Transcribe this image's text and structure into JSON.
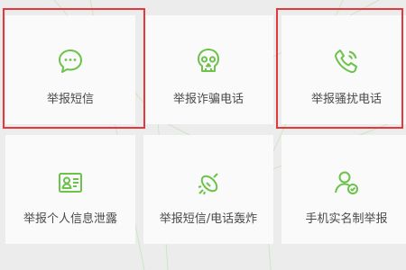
{
  "accent_color": "#6cc24a",
  "highlight_color": "#e4393c",
  "tiles": [
    {
      "label": "举报短信",
      "icon": "chat-bubble-icon",
      "highlighted": true
    },
    {
      "label": "举报诈骗电话",
      "icon": "skull-icon",
      "highlighted": false
    },
    {
      "label": "举报骚扰电话",
      "icon": "phone-icon",
      "highlighted": true
    },
    {
      "label": "举报个人信息泄露",
      "icon": "id-card-icon",
      "highlighted": false
    },
    {
      "label": "举报短信/电话轰炸",
      "icon": "bomb-icon",
      "highlighted": false
    },
    {
      "label": "手机实名制举报",
      "icon": "user-verified-icon",
      "highlighted": false
    }
  ]
}
